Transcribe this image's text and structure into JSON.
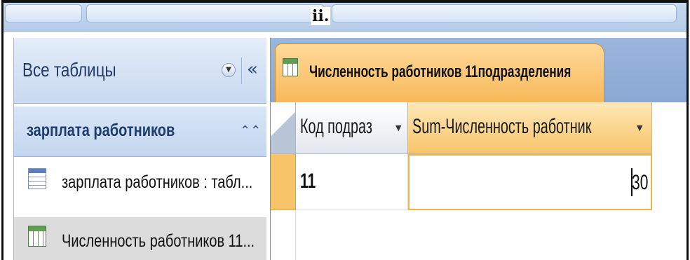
{
  "caption": "ii.",
  "navigation_pane": {
    "title": "Все таблицы",
    "menu_icon": "chevron-down-circle-icon",
    "collapse_icon": "double-chevron-left-icon",
    "group": {
      "title": "зарплата работников",
      "collapse_icon": "double-chevron-up-icon"
    },
    "items": [
      {
        "label": "зарплата работников : табл...",
        "icon": "table-icon",
        "selected": false
      },
      {
        "label": "Численность работников 11...",
        "icon": "query-icon",
        "selected": true
      }
    ]
  },
  "document": {
    "tab_label": "Численность работников 11подразделения",
    "tab_icon": "query-icon",
    "columns": [
      {
        "header": "Код подраз",
        "sort_icon": "dropdown-arrow-icon"
      },
      {
        "header": "Sum-Численность работник",
        "sort_icon": "dropdown-arrow-icon"
      }
    ],
    "rows": [
      {
        "c1": "11",
        "c2": "30"
      }
    ]
  },
  "colors": {
    "accent_orange": "#f7c46a",
    "nav_blue": "#c8d9f0",
    "tab_strip_blue": "#8aa8d3"
  }
}
